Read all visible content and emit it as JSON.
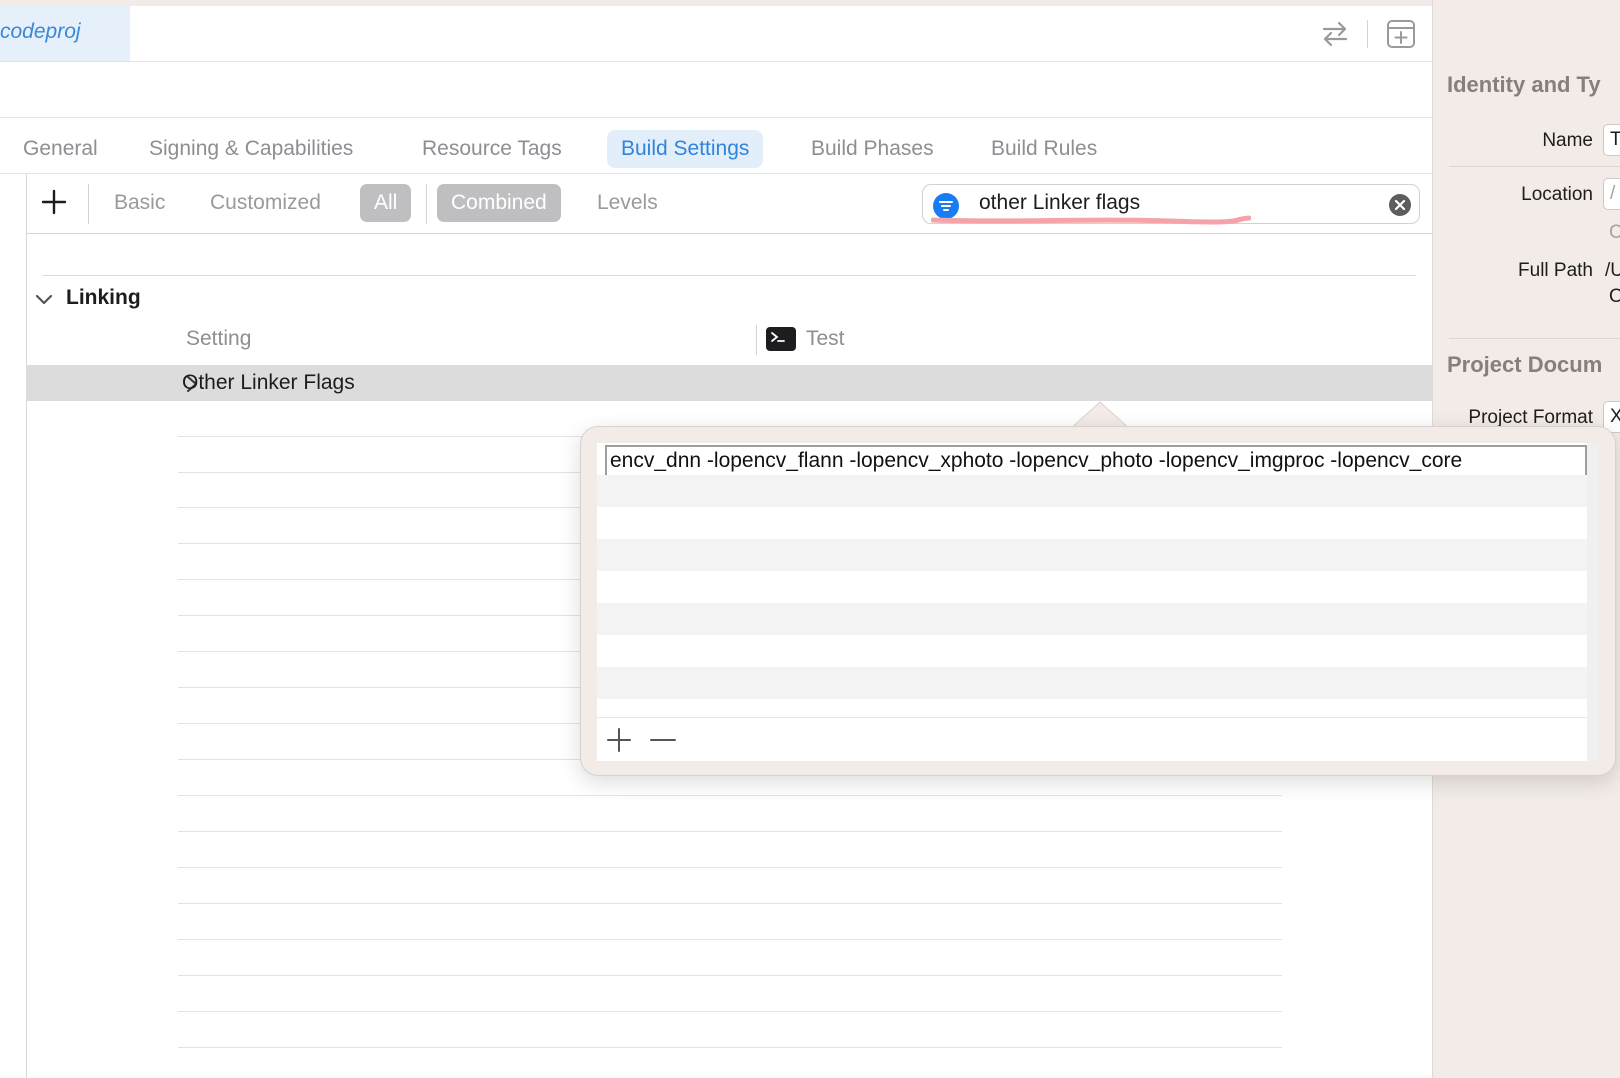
{
  "file_tab": {
    "label": "codeproj"
  },
  "editor_tabs": [
    {
      "label": "General",
      "active": false
    },
    {
      "label": "Signing & Capabilities",
      "active": false
    },
    {
      "label": "Resource Tags",
      "active": false
    },
    {
      "label": "Build Settings",
      "active": true
    },
    {
      "label": "Build Phases",
      "active": false
    },
    {
      "label": "Build Rules",
      "active": false
    }
  ],
  "filter_bar": {
    "basic_label": "Basic",
    "customized_label": "Customized",
    "all_label": "All",
    "combined_label": "Combined",
    "levels_label": "Levels",
    "search_value": "other Linker flags"
  },
  "section": {
    "title": "Linking",
    "col_setting": "Setting",
    "col_target": "Test",
    "row_label": "Other Linker Flags"
  },
  "popover": {
    "flag_value": "encv_dnn -lopencv_flann -lopencv_xphoto -lopencv_photo -lopencv_imgproc -lopencv_core"
  },
  "inspector": {
    "identity_header": "Identity and Ty",
    "name_label": "Name",
    "name_value": "T",
    "location_label": "Location",
    "location_value": "/",
    "location_sub": "C",
    "full_path_label": "Full Path",
    "full_path_value_1": "/U",
    "full_path_value_2": "O",
    "project_doc_header": "Project Docum",
    "project_format_label": "Project Format",
    "project_format_value": "X"
  },
  "colors": {
    "accent": "#2f84dc",
    "inspector_bg": "#f2ebe7",
    "selected_row": "#dcdcdc",
    "search_annotation": "#f4a3a8"
  }
}
